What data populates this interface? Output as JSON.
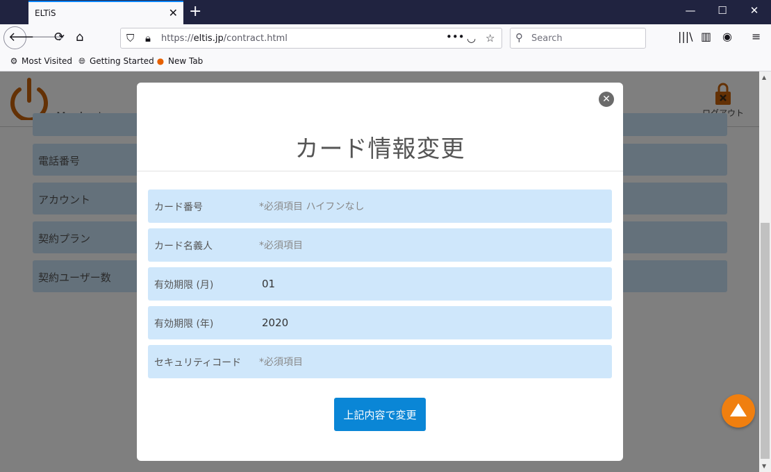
{
  "browser": {
    "tab_title": "ELTiS",
    "tab_close": "✕",
    "new_tab": "+",
    "window_min": "—",
    "window_max": "☐",
    "window_close": "✕",
    "url_prefix": "https://",
    "url_host": "eltis.jp",
    "url_path": "/contract.html",
    "search_placeholder": "Search",
    "bookmarks": [
      {
        "label": "Most Visited",
        "icon": "gear-icon"
      },
      {
        "label": "Getting Started",
        "icon": "globe-icon"
      },
      {
        "label": "New Tab",
        "icon": "firefox-icon"
      }
    ]
  },
  "site": {
    "member_label": "Menber's",
    "logout_label": "ログアウト",
    "list_rows": [
      "電話番号",
      "アカウント",
      "契約プラン",
      "契約ユーザー数"
    ],
    "logo_color": "#c8620b"
  },
  "modal": {
    "title": "カード情報変更",
    "close_label": "✕",
    "fields": [
      {
        "label": "カード番号",
        "placeholder": "*必須項目 ハイフンなし",
        "value": ""
      },
      {
        "label": "カード名義人",
        "placeholder": "*必須項目",
        "value": ""
      },
      {
        "label": "有効期限 (月)",
        "placeholder": "",
        "value": "01"
      },
      {
        "label": "有効期限 (年)",
        "placeholder": "",
        "value": "2020"
      },
      {
        "label": "セキュリティコード",
        "placeholder": "*必須項目",
        "value": ""
      }
    ],
    "submit_label": "上記内容で変更"
  },
  "colors": {
    "accent": "#0a86d6",
    "field_bg": "#cfe7fb",
    "fab": "#f07f0f"
  }
}
